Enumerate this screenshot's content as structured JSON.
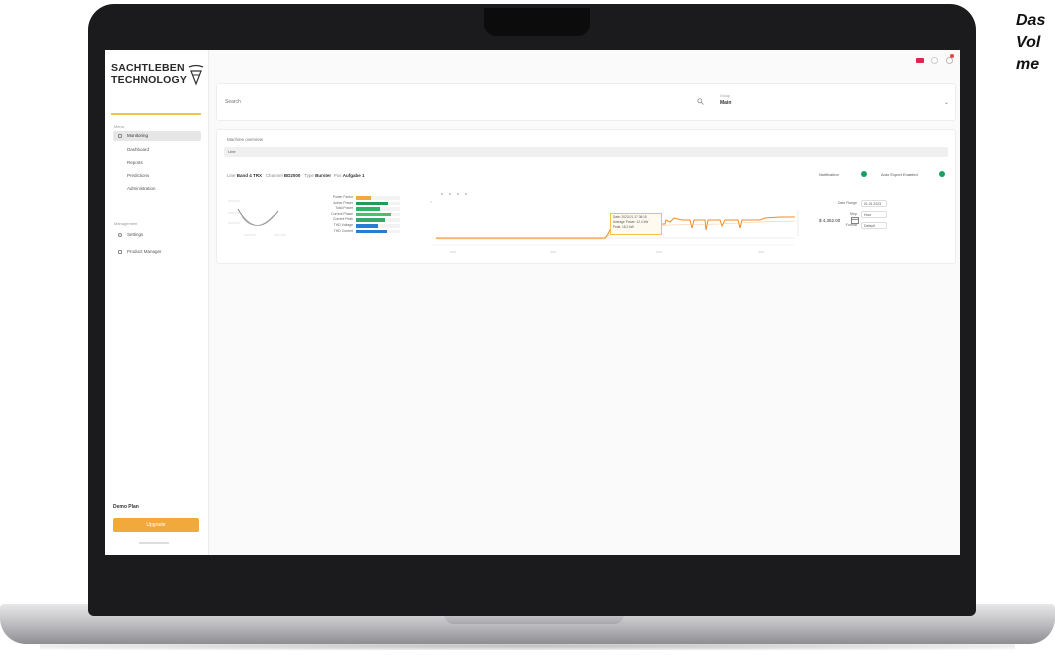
{
  "caption": {
    "lines": [
      "Das",
      "Vol",
      "me"
    ]
  },
  "sidebar": {
    "logo_lines": [
      "SACHTLEBEN",
      "TECHNOLOGY"
    ],
    "section_monitoring": "Menu",
    "items": [
      {
        "label": "Monitoring",
        "active": true
      },
      {
        "label": "Dashboard",
        "active": false
      },
      {
        "label": "Reports",
        "active": false
      },
      {
        "label": "Predictions",
        "active": false
      },
      {
        "label": "Administration",
        "active": false
      }
    ],
    "section_settings": "Management",
    "settings_items": [
      {
        "label": "Settings"
      },
      {
        "label": "Product Manager"
      }
    ],
    "trial_label": "Demo Plan",
    "upgrade_label": "Upgrade"
  },
  "topbar": {
    "icons": [
      "flag-icon",
      "bell-icon",
      "notification-icon",
      "settings-icon",
      "avatar"
    ],
    "colors": {
      "flag": "#d9264a",
      "badge": "#e8463c",
      "avatar": "#3a3f99",
      "accent": "#f2a93b",
      "success": "#18a05f",
      "line_orange": "#f08a24"
    }
  },
  "search": {
    "placeholder": "Search",
    "filter_label": "Group",
    "filter_value": "Main"
  },
  "content": {
    "section_title": "Machine overview",
    "subbar_label": "Line",
    "meta": {
      "k1": "Line",
      "v1": "Band 4 TRX",
      "k2": "Channel",
      "v2": "BD2000",
      "k3": "Type",
      "v3": "Burster",
      "k4": "Pos",
      "v4": "Aufgabe 1"
    },
    "toggle1_label": "Notification",
    "toggle2_label": "Auto Export Enabled",
    "bar_labels": [
      "Power Factor",
      "Active Power",
      "Total Power",
      "Current Phase",
      "Current Peak",
      "THD Voltage",
      "THD Current"
    ],
    "bar_values": [
      0.35,
      0.72,
      0.55,
      0.8,
      0.65,
      0.5,
      0.7
    ],
    "tooltip": [
      "Date: 2023-01-17 08:15",
      "Average Power: 12.4 kW",
      "Peak: 18.2 kW"
    ],
    "price": "$ 4,352.00",
    "form": {
      "label1": "Date Range",
      "value1": "01.01.2023",
      "label2": "Step",
      "value2": "Hour",
      "label3": "Format",
      "value3": "Default"
    }
  }
}
